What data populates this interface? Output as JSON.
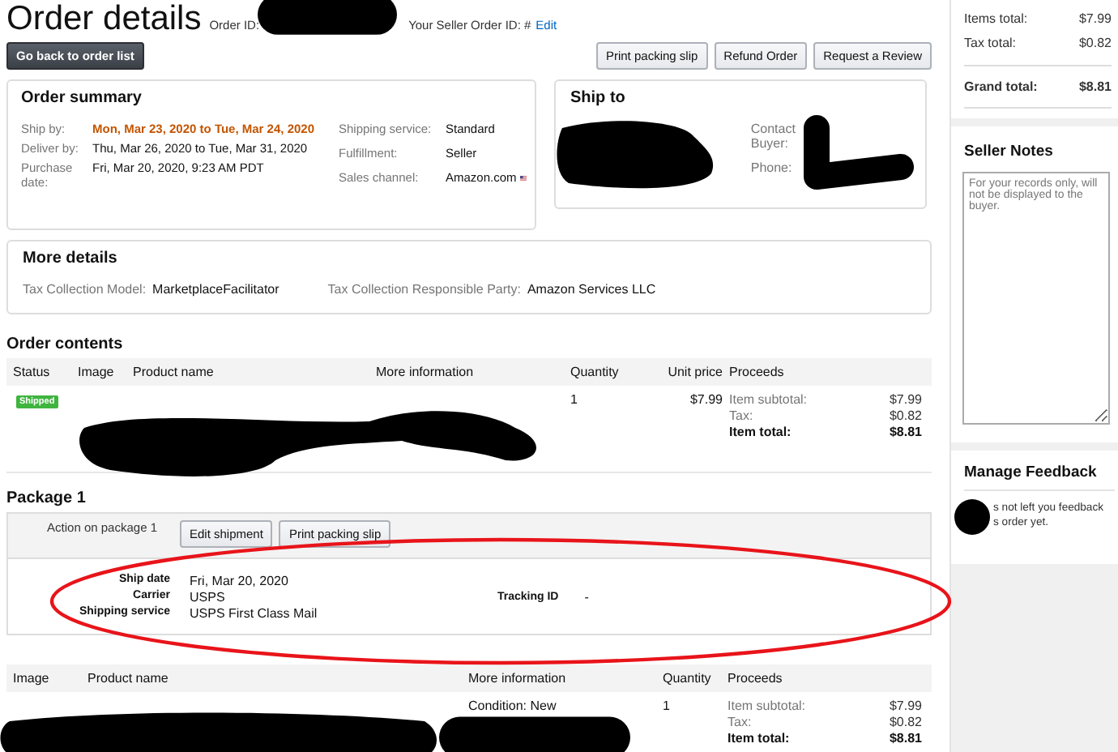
{
  "header": {
    "title": "Order details",
    "order_id_label": "Order ID:",
    "seller_order_id_label": "Your Seller Order ID: #",
    "edit_link": "Edit"
  },
  "back_button": "Go back to order list",
  "actions": [
    "Print packing slip",
    "Refund Order",
    "Request a Review"
  ],
  "order_summary": {
    "title": "Order summary",
    "left": [
      {
        "label": "Ship by:",
        "value": "Mon, Mar 23, 2020 to Tue, Mar 24, 2020",
        "highlight": true
      },
      {
        "label": "Deliver by:",
        "value": "Thu, Mar 26, 2020 to Tue, Mar 31, 2020",
        "highlight": false
      },
      {
        "label": "Purchase date:",
        "value": "Fri, Mar 20, 2020, 9:23 AM PDT",
        "highlight": false
      }
    ],
    "right": [
      {
        "label": "Shipping service:",
        "value": "Standard",
        "flag": false
      },
      {
        "label": "Fulfillment:",
        "value": "Seller",
        "flag": false
      },
      {
        "label": "Sales channel:",
        "value": "Amazon.com",
        "flag": true
      }
    ]
  },
  "ship_to": {
    "title": "Ship to",
    "contact_label": "Contact Buyer:",
    "phone_label": "Phone:"
  },
  "more_details": {
    "title": "More details",
    "fields": [
      {
        "label": "Tax Collection Model:",
        "value": "MarketplaceFacilitator"
      },
      {
        "label": "Tax Collection Responsible Party:",
        "value": "Amazon Services LLC"
      }
    ]
  },
  "order_contents": {
    "title": "Order contents",
    "columns": [
      "Status",
      "Image",
      "Product name",
      "More information",
      "Quantity",
      "Unit price",
      "Proceeds"
    ],
    "rows": [
      {
        "status": "Shipped",
        "quantity": "1",
        "unit_price": "$7.99",
        "proceeds": [
          {
            "label": "Item subtotal:",
            "value": "$7.99",
            "bold": false
          },
          {
            "label": "Tax:",
            "value": "$0.82",
            "bold": false
          },
          {
            "label": "Item total:",
            "value": "$8.81",
            "bold": true
          }
        ]
      }
    ]
  },
  "package": {
    "title": "Package 1",
    "action_label": "Action on package 1",
    "buttons": [
      "Edit shipment",
      "Print packing slip"
    ],
    "details": [
      {
        "label": "Ship date",
        "value": "Fri, Mar 20, 2020"
      },
      {
        "label": "Carrier",
        "value": "USPS"
      },
      {
        "label": "Shipping service",
        "value": "USPS First Class Mail"
      }
    ],
    "tracking_label": "Tracking ID",
    "tracking_value": "-",
    "columns": [
      "Image",
      "Product name",
      "More information",
      "Quantity",
      "Proceeds"
    ],
    "rows": [
      {
        "more_information": "Condition: New",
        "quantity": "1",
        "proceeds": [
          {
            "label": "Item subtotal:",
            "value": "$7.99",
            "bold": false
          },
          {
            "label": "Tax:",
            "value": "$0.82",
            "bold": false
          },
          {
            "label": "Item total:",
            "value": "$8.81",
            "bold": true
          }
        ]
      }
    ]
  },
  "sidebar": {
    "totals": [
      {
        "label": "Items total:",
        "value": "$7.99",
        "bold": false
      },
      {
        "label": "Tax total:",
        "value": "$0.82",
        "bold": false
      },
      {
        "label": "Grand total:",
        "value": "$8.81",
        "bold": true
      }
    ],
    "seller_notes": {
      "title": "Seller Notes",
      "placeholder": "For your records only, will not be displayed to the buyer."
    },
    "feedback": {
      "title": "Manage Feedback",
      "message_lines": [
        "s not left you feedback",
        "s order yet."
      ]
    }
  }
}
